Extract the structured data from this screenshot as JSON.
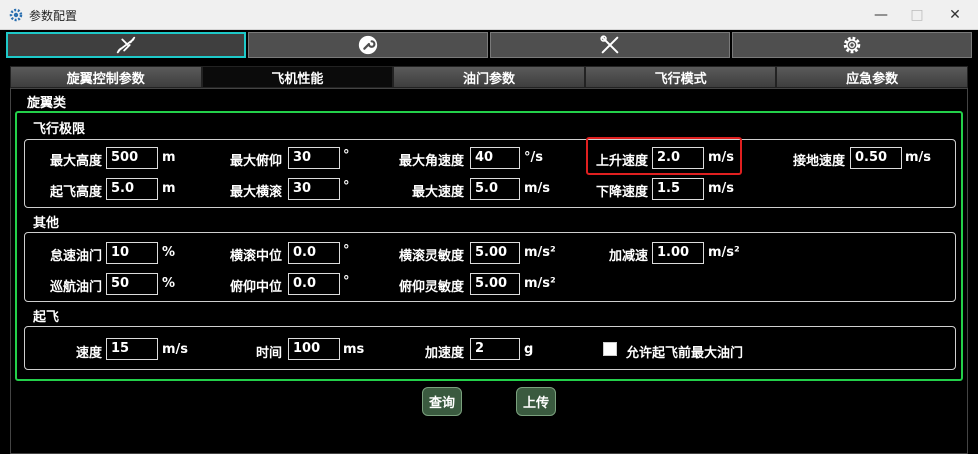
{
  "window": {
    "title": "参数配置"
  },
  "top_tabs": [
    {
      "icon": "plane-icon"
    },
    {
      "icon": "wrench-circle-icon"
    },
    {
      "icon": "tools-icon"
    },
    {
      "icon": "gear-icon"
    }
  ],
  "sub_tabs": [
    "旋翼控制参数",
    "飞机性能",
    "油门参数",
    "飞行模式",
    "应急参数"
  ],
  "active_sub_tab": "飞机性能",
  "section": {
    "title": "旋翼类"
  },
  "groups": {
    "flight_limits": {
      "title": "飞行极限",
      "max_altitude": {
        "label": "最大高度",
        "value": "500",
        "unit": "m"
      },
      "takeoff_altitude": {
        "label": "起飞高度",
        "value": "5.0",
        "unit": "m"
      },
      "max_pitch": {
        "label": "最大俯仰",
        "value": "30",
        "unit": "°"
      },
      "max_roll": {
        "label": "最大横滚",
        "value": "30",
        "unit": "°"
      },
      "max_angular_speed": {
        "label": "最大角速度",
        "value": "40",
        "unit": "°/s"
      },
      "max_speed": {
        "label": "最大速度",
        "value": "5.0",
        "unit": "m/s"
      },
      "climb_speed": {
        "label": "上升速度",
        "value": "2.0",
        "unit": "m/s"
      },
      "descent_speed": {
        "label": "下降速度",
        "value": "1.5",
        "unit": "m/s"
      },
      "landing_speed": {
        "label": "接地速度",
        "value": "0.50",
        "unit": "m/s"
      }
    },
    "other": {
      "title": "其他",
      "idle_throttle": {
        "label": "怠速油门",
        "value": "10",
        "unit": "%"
      },
      "cruise_throttle": {
        "label": "巡航油门",
        "value": "50",
        "unit": "%"
      },
      "roll_neutral": {
        "label": "横滚中位",
        "value": "0.0",
        "unit": "°"
      },
      "pitch_neutral": {
        "label": "俯仰中位",
        "value": "0.0",
        "unit": "°"
      },
      "roll_sensitivity": {
        "label": "横滚灵敏度",
        "value": "5.00",
        "unit": "m/s²"
      },
      "pitch_sensitivity": {
        "label": "俯仰灵敏度",
        "value": "5.00",
        "unit": "m/s²"
      },
      "accel_decel": {
        "label": "加减速",
        "value": "1.00",
        "unit": "m/s²"
      }
    },
    "takeoff": {
      "title": "起飞",
      "speed": {
        "label": "速度",
        "value": "15",
        "unit": "m/s"
      },
      "time": {
        "label": "时间",
        "value": "100",
        "unit": "ms"
      },
      "acceleration": {
        "label": "加速度",
        "value": "2",
        "unit": "g"
      },
      "allow_max_throttle": {
        "label": "允许起飞前最大油门",
        "checked": false
      }
    }
  },
  "actions": {
    "query": "查询",
    "upload": "上传"
  },
  "colors": {
    "group_border": "#23d04a",
    "active_tab_border": "#1ec9c9",
    "highlight": "#e02020",
    "button": "#3a5a3f"
  }
}
